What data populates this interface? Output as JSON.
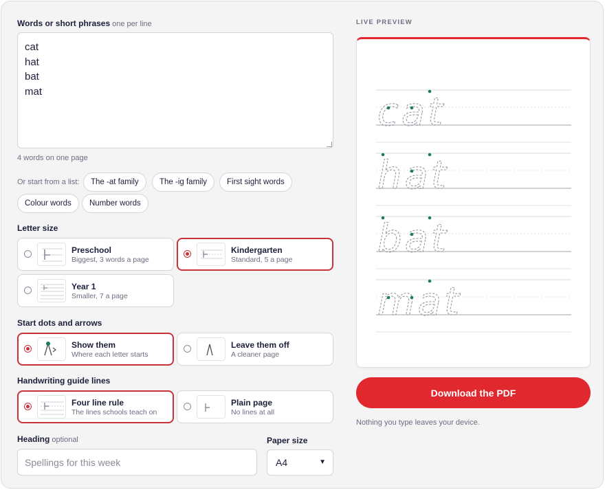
{
  "words_field": {
    "label": "Words or short phrases",
    "hint": "one per line",
    "value": "cat\nhat\nbat\nmat",
    "count_text": "4 words on one page"
  },
  "starter_lists": {
    "label": "Or start from a list:",
    "items": [
      "The -at family",
      "The -ig family",
      "First sight words",
      "Colour words",
      "Number words"
    ]
  },
  "letter_size": {
    "label": "Letter size",
    "selected": "Kindergarten",
    "options": [
      {
        "title": "Preschool",
        "desc": "Biggest, 3 words a page"
      },
      {
        "title": "Kindergarten",
        "desc": "Standard, 5 a page"
      },
      {
        "title": "Year 1",
        "desc": "Smaller, 7 a page"
      }
    ]
  },
  "start_dots": {
    "label": "Start dots and arrows",
    "selected": "Show them",
    "options": [
      {
        "title": "Show them",
        "desc": "Where each letter starts"
      },
      {
        "title": "Leave them off",
        "desc": "A cleaner page"
      }
    ]
  },
  "guide_lines": {
    "label": "Handwriting guide lines",
    "selected": "Four line rule",
    "options": [
      {
        "title": "Four line rule",
        "desc": "The lines schools teach on"
      },
      {
        "title": "Plain page",
        "desc": "No lines at all"
      }
    ]
  },
  "heading": {
    "label": "Heading",
    "hint": "optional",
    "placeholder": "Spellings for this week",
    "value": ""
  },
  "paper_size": {
    "label": "Paper size",
    "value": "A4"
  },
  "preview": {
    "label": "LIVE PREVIEW",
    "words": [
      "cat",
      "hat",
      "bat",
      "mat"
    ]
  },
  "download_label": "Download the PDF",
  "privacy_note": "Nothing you type leaves your device.",
  "colors": {
    "accent": "#e0282e",
    "selected_border": "#c9323a",
    "start_dot": "#1e7a5a",
    "text": "#1c1f3a",
    "muted": "#6b6e80"
  },
  "icons": {
    "radio": "radio-icon",
    "thumbnail": "guide-lines-thumbnail-icon",
    "select": "chevron-down-icon"
  }
}
